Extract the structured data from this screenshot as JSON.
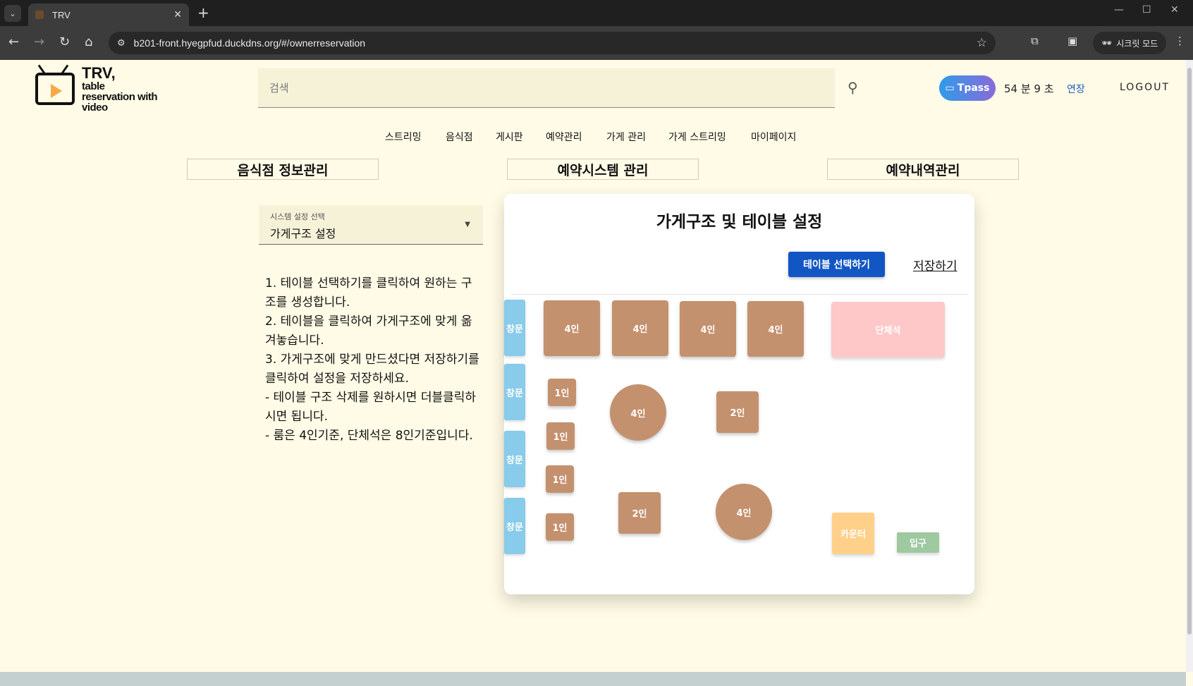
{
  "browser": {
    "tab_title": "TRV",
    "url": "b201-front.hyegpfud.duckdns.org/#/ownerreservation",
    "incognito_label": "시크릿 모드"
  },
  "header": {
    "logo_title": "TRV,",
    "logo_sub1": "table",
    "logo_sub2": "reservation with",
    "logo_sub3": "video",
    "search_placeholder": "검색",
    "tpass_label": "Tpass",
    "timer": "54 분 9 초",
    "extend_label": "연장",
    "logout_label": "LOGOUT"
  },
  "nav": {
    "items": [
      "스트리밍",
      "음식점",
      "게시판",
      "예약관리",
      "가게 관리",
      "가게 스트리밍",
      "마이페이지"
    ]
  },
  "sections": {
    "tabs": [
      "음식점 정보관리",
      "예약시스템 관리",
      "예약내역관리"
    ]
  },
  "settings": {
    "select_label": "시스템 설정 선택",
    "select_value": "가게구조 설정",
    "instructions": [
      "1. 테이블 선택하기를 클릭하여 원하는 구조를 생성합니다.",
      "2. 테이블을 클릭하여 가게구조에 맞게 옮겨놓습니다.",
      "3. 가게구조에 맞게 만드셨다면 저장하기를 클릭하여 설정을 저장하세요.",
      "- 테이블 구조 삭제를 원하시면 더블클릭하시면 됩니다.",
      "- 룸은 4인기준, 단체석은 8인기준입니다."
    ]
  },
  "layout_editor": {
    "title": "가게구조 및 테이블 설정",
    "select_button": "테이블 선택하기",
    "save_button": "저장하기",
    "windows": [
      "창문",
      "창문",
      "창문",
      "창문"
    ],
    "tables_top": [
      "4인",
      "4인",
      "4인",
      "4인"
    ],
    "group_seat": "단체석",
    "small_tables": [
      "1인",
      "1인",
      "1인",
      "1인"
    ],
    "round_table_1": "4인",
    "round_table_2": "4인",
    "two_table_1": "2인",
    "two_table_2": "2인",
    "counter": "카운터",
    "entrance": "입구"
  },
  "colors": {
    "page_bg": "#fffbe6",
    "table": "#c4916e",
    "window": "#89cbea",
    "group": "#ffc8c8",
    "counter": "#ffd08a",
    "entrance": "#9fc9a1",
    "primary_button": "#1256c4"
  }
}
